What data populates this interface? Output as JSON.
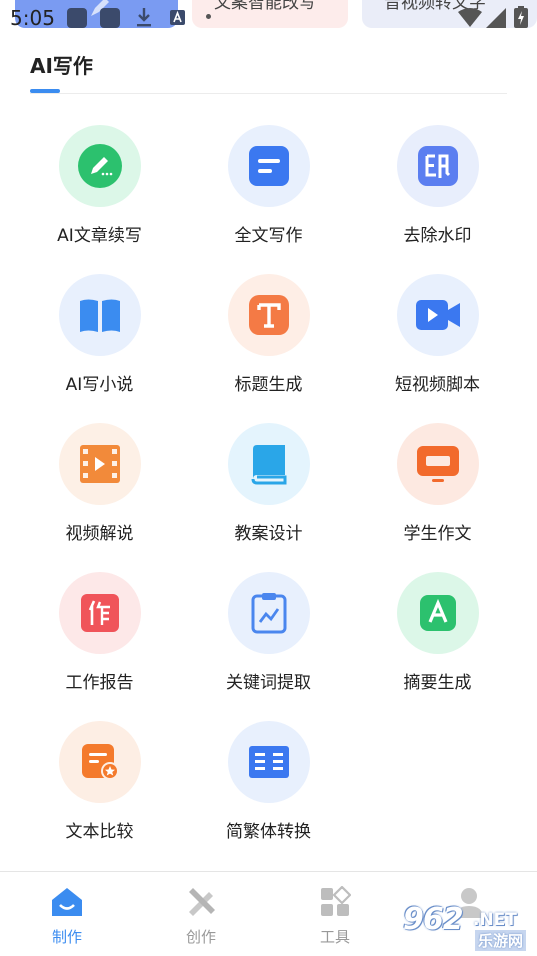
{
  "status_bar": {
    "time": "5:05",
    "banners": [
      "",
      "文案智能改写",
      "音视频转文字"
    ],
    "icons": [
      "app-square-icon",
      "app-square-icon",
      "download-icon",
      "a-box-icon",
      "wifi-icon",
      "signal-icon",
      "battery-charging-icon"
    ]
  },
  "header": {
    "title": "AI写作",
    "accent_color": "#3b8cf0"
  },
  "tools": [
    {
      "label": "AI文章续写",
      "icon": "pen-icon",
      "bg": "#dcf7e8",
      "color": "#2cc16e"
    },
    {
      "label": "全文写作",
      "icon": "document-lines-icon",
      "bg": "#e8f0fd",
      "color": "#3b78f0"
    },
    {
      "label": "去除水印",
      "icon": "stamp-icon",
      "bg": "#e8eefc",
      "color": "#5b7ef0"
    },
    {
      "label": "AI写小说",
      "icon": "open-book-icon",
      "bg": "#e8f0fd",
      "color": "#3b8cf0"
    },
    {
      "label": "标题生成",
      "icon": "text-t-icon",
      "bg": "#feeee6",
      "color": "#f47a45"
    },
    {
      "label": "短视频脚本",
      "icon": "video-camera-icon",
      "bg": "#e8f0fd",
      "color": "#3b78f0"
    },
    {
      "label": "视频解说",
      "icon": "film-strip-icon",
      "bg": "#fdf0e6",
      "color": "#f28a3a"
    },
    {
      "label": "教案设计",
      "icon": "textbook-icon",
      "bg": "#e4f4fd",
      "color": "#2aa6e8"
    },
    {
      "label": "学生作文",
      "icon": "monitor-icon",
      "bg": "#fde9e1",
      "color": "#f26a2c"
    },
    {
      "label": "工作报告",
      "icon": "report-icon",
      "bg": "#fde8e8",
      "color": "#f0545a"
    },
    {
      "label": "关键词提取",
      "icon": "clipboard-chart-icon",
      "bg": "#e8f0fd",
      "color": "#4a86ee"
    },
    {
      "label": "摘要生成",
      "icon": "letter-a-icon",
      "bg": "#dcf7e8",
      "color": "#2cc16e"
    },
    {
      "label": "文本比较",
      "icon": "file-star-icon",
      "bg": "#fdeee4",
      "color": "#f47a2c"
    },
    {
      "label": "简繁体转换",
      "icon": "book-grid-icon",
      "bg": "#e8f0fd",
      "color": "#3b78f0"
    }
  ],
  "bottom_nav": [
    {
      "label": "制作",
      "icon": "home-icon",
      "active": true
    },
    {
      "label": "创作",
      "icon": "ruler-pen-icon",
      "active": false
    },
    {
      "label": "工具",
      "icon": "grid-tools-icon",
      "active": false
    },
    {
      "label": "",
      "icon": "person-icon",
      "active": false
    }
  ],
  "watermark": {
    "number": "962",
    "domain": ".NET",
    "sub": "乐游网"
  }
}
